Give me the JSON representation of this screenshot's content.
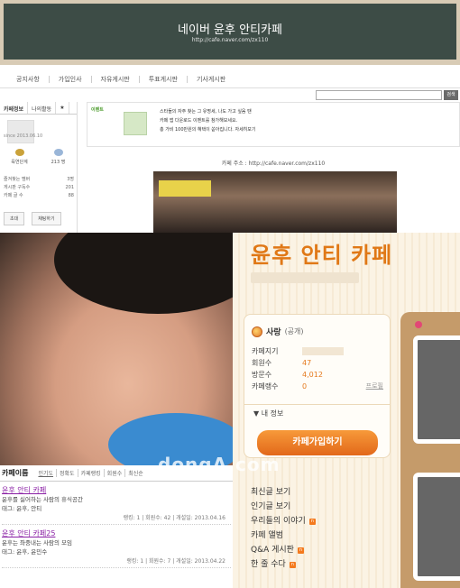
{
  "top_panel": {
    "banner": {
      "title": "네이버 윤후 안티카페",
      "url": "http://cafe.naver.com/zx110"
    },
    "menu": [
      "공지사항",
      "가입인사",
      "자유게시판",
      "투표게시판",
      "기사게시판"
    ],
    "search_button": "검색",
    "left_box": {
      "tabs": [
        "카페정보",
        "나의활동",
        "★"
      ],
      "since": "since 2013.06.10",
      "badges": [
        {
          "label": "육연단계"
        },
        {
          "label": "213 명"
        }
      ],
      "stats": [
        {
          "label": "즐겨찾는 멤버",
          "value": "3명"
        },
        {
          "label": "게시판 구독수",
          "value": "201"
        },
        {
          "label": "카페 글 수",
          "value": "88"
        }
      ],
      "buttons": [
        "초대",
        "채팅하기"
      ]
    },
    "event": {
      "tag": "이벤트",
      "lines": [
        "스타들의 자주 찾는 그 유명세, 나도 가고 싶음 땐",
        "카페 앱 다운로드 이벤트를 참가해보세요.",
        "총 가비 100만원의 혜택이 쏟아집니다.  자세히보기"
      ]
    },
    "cafe_address": "카페 주소 : http://cafe.naver.com/zx110"
  },
  "results": {
    "title": "카페이름",
    "sort_options": [
      "인기도",
      "정확도",
      "카페랭킹",
      "회원수",
      "최신순"
    ],
    "items": [
      {
        "name": "윤후 안티 카페",
        "desc": "윤후를 싫어하는 사람의 휴식공간",
        "tags": "태그: 윤후, 안티",
        "meta": "랭킹: 1  |  회원수: 42  |  개설일: 2013.04.16"
      },
      {
        "name": "윤후 안티 카페25",
        "desc": "윤후는 좌중내는 사람의 모임",
        "tags": "태그: 윤후, 윤민수",
        "meta": "랭킹: 1  |  회원수: 7  |  개설일: 2013.04.22"
      }
    ]
  },
  "profile": {
    "cafe_name": "윤후 안티 카페",
    "owner_level": "사랑",
    "visibility": "(공개)",
    "rows": [
      {
        "label": "카페지기",
        "value": ""
      },
      {
        "label": "회원수",
        "value": "47"
      },
      {
        "label": "방문수",
        "value": "4,012"
      },
      {
        "label": "카페랭수",
        "value": "0"
      }
    ],
    "profile_link": "프로필",
    "my_info": "내 정보",
    "join_button": "카페가입하기",
    "menu": [
      {
        "label": "최신글 보기",
        "new": false
      },
      {
        "label": "인기글 보기",
        "new": false
      },
      {
        "label": "우리들의 이야기",
        "new": true
      },
      {
        "label": "카페 앨범",
        "new": false
      },
      {
        "label": "Q&A 게시판",
        "new": true
      },
      {
        "label": "한 줄 수다",
        "new": true
      }
    ]
  },
  "watermark": "dongA.com"
}
